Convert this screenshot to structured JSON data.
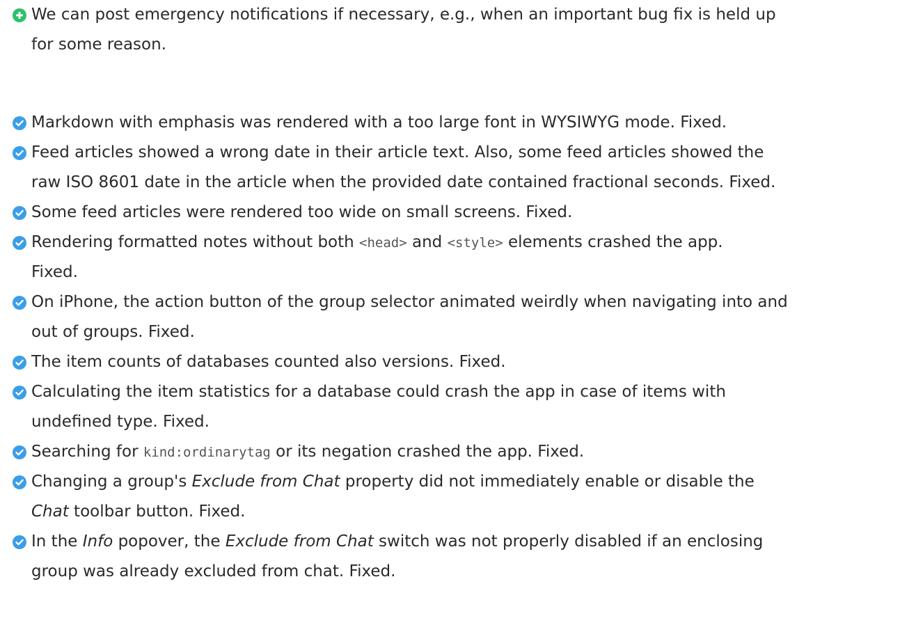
{
  "colors": {
    "new_bullet": "#2fbf6a",
    "fixed_bullet": "#3b9ee8",
    "text": "#2a2a2a"
  },
  "items": [
    {
      "icon": "plus-circle-icon",
      "line1": "We can post emergency notifications if necessary, e.g., when an important bug fix is held up",
      "line2": "for some reason."
    },
    {
      "icon": "checkmark-circle-icon",
      "line1": "Markdown with emphasis was rendered with a too large font in WYSIWYG mode. Fixed."
    },
    {
      "icon": "checkmark-circle-icon",
      "line1": "Feed articles showed a wrong date in their article text. Also, some feed articles showed the",
      "line2": "raw ISO 8601 date in the article when the provided date contained fractional seconds. Fixed."
    },
    {
      "icon": "checkmark-circle-icon",
      "line1": "Some feed articles were rendered too wide on small screens. Fixed."
    },
    {
      "icon": "checkmark-circle-icon",
      "line1_a": "Rendering formatted notes without both ",
      "line1_code1": "<head>",
      "line1_b": " and ",
      "line1_code2": "<style>",
      "line1_c": " elements crashed the app.",
      "line2": "Fixed."
    },
    {
      "icon": "checkmark-circle-icon",
      "line1": "On iPhone, the action button of the group selector animated weirdly when navigating into and",
      "line2": "out of groups. Fixed."
    },
    {
      "icon": "checkmark-circle-icon",
      "line1": "The item counts of databases counted also versions. Fixed."
    },
    {
      "icon": "checkmark-circle-icon",
      "line1": "Calculating the item statistics for a database could crash the app in case of items with",
      "line2": "undefined type. Fixed."
    },
    {
      "icon": "checkmark-circle-icon",
      "line1_a": "Searching for ",
      "line1_code": "kind:ordinarytag",
      "line1_b": " or its negation crashed the app. Fixed."
    },
    {
      "icon": "checkmark-circle-icon",
      "line1_a": "Changing a group's ",
      "line1_em": "Exclude from Chat",
      "line1_b": " property did not immediately enable or disable the",
      "line2_em": "Chat",
      "line2_b": " toolbar button. Fixed."
    },
    {
      "icon": "checkmark-circle-icon",
      "line1_a": "In the ",
      "line1_em1": "Info",
      "line1_b": " popover, the ",
      "line1_em2": "Exclude from Chat",
      "line1_c": " switch was not properly disabled if an enclosing",
      "line2": "group was already excluded from chat. Fixed."
    }
  ]
}
